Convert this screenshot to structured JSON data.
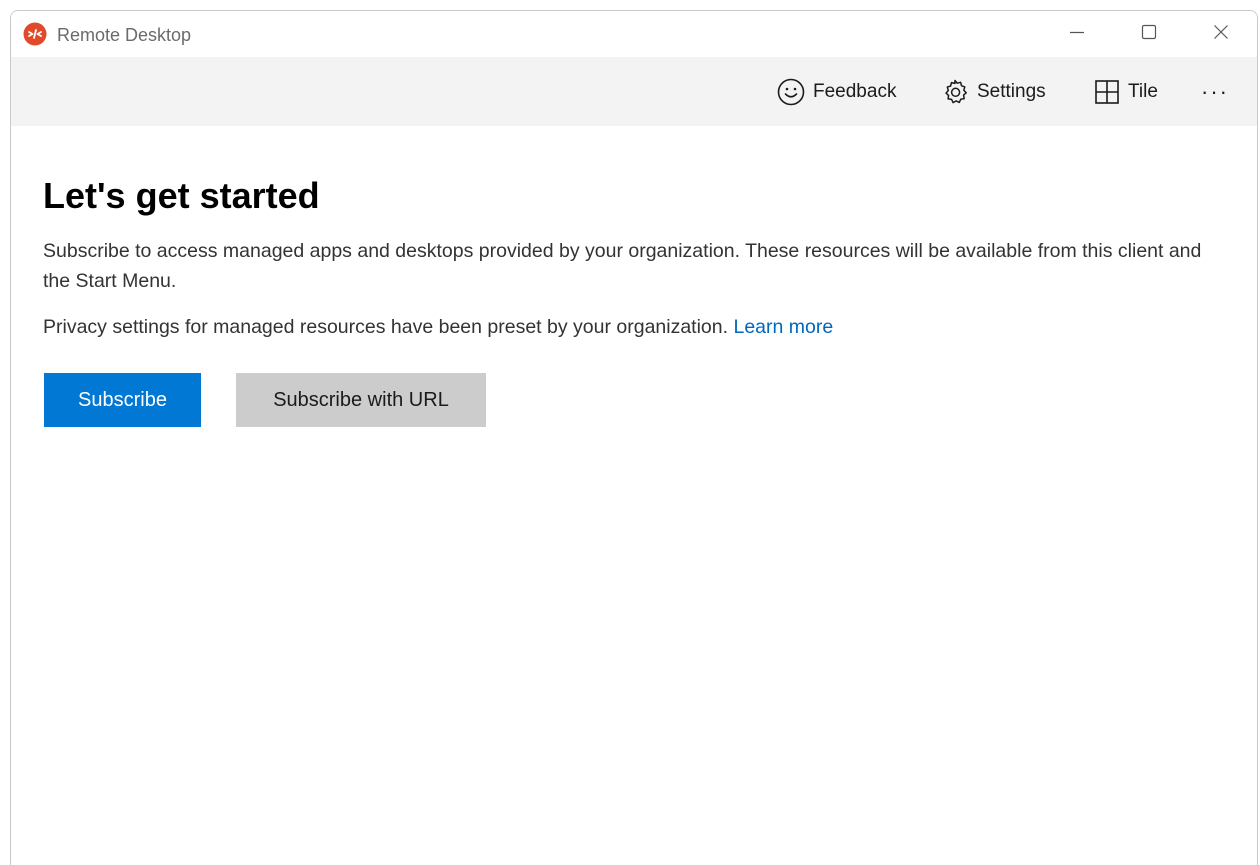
{
  "window": {
    "title": "Remote Desktop"
  },
  "toolbar": {
    "feedback_label": "Feedback",
    "settings_label": "Settings",
    "tile_label": "Tile",
    "more_label": "···"
  },
  "main": {
    "heading": "Let's get started",
    "description": "Subscribe to access managed apps and desktops provided by your organization. These resources will be available from this client and the Start Menu.",
    "privacy_text": "Privacy settings for managed resources have been preset by your organization.",
    "learn_more_label": "Learn more",
    "subscribe_label": "Subscribe",
    "subscribe_url_label": "Subscribe with URL"
  },
  "colors": {
    "accent": "#0078d4",
    "link": "#0067c0",
    "app_icon": "#e04a2a",
    "secondary_button": "#cccccc",
    "command_bar": "#f3f3f3"
  },
  "icons": {
    "app": "remote-desktop-icon",
    "feedback": "smiley-icon",
    "settings": "gear-icon",
    "tile": "grid-icon",
    "minimize": "minimize-icon",
    "maximize": "maximize-icon",
    "close": "close-icon"
  }
}
